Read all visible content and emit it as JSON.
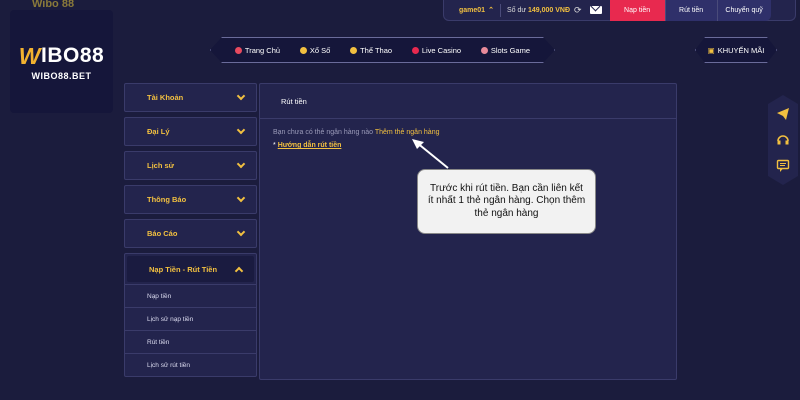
{
  "brand": {
    "logo_prefix": "W",
    "logo_rest": "IBO88",
    "logo_domain": "WIBO88.BET",
    "top_partial": "Wibo 88"
  },
  "topbar": {
    "username": "game01",
    "balance_label": "Số dư",
    "balance_value": "149,000 VNĐ",
    "deposit": "Nạp tiền",
    "withdraw": "Rút tiền",
    "transfer": "Chuyển quỹ"
  },
  "nav": {
    "items": [
      {
        "label": "Trang Chủ",
        "color": "#e84a5f"
      },
      {
        "label": "Xổ Số",
        "color": "#f2c040"
      },
      {
        "label": "Thể Thao",
        "color": "#f2c040"
      },
      {
        "label": "Live Casino",
        "color": "#e8294f"
      },
      {
        "label": "Slots Game",
        "color": "#e88a9a"
      }
    ],
    "promo": "KHUYẾN MÃI"
  },
  "sidebar": {
    "items": [
      {
        "label": "Tài Khoản"
      },
      {
        "label": "Đại Lý"
      },
      {
        "label": "Lịch sử"
      },
      {
        "label": "Thông Báo"
      },
      {
        "label": "Báo Cáo"
      }
    ],
    "group": {
      "label": "Nạp Tiền - Rút Tiền",
      "children": [
        "Nạp tiền",
        "Lịch sử nạp tiền",
        "Rút tiền",
        "Lịch sử rút tiền"
      ]
    }
  },
  "panel": {
    "title": "Rút tiền",
    "no_bank_text": "Bạn chưa có thẻ ngân hàng nào",
    "add_bank_link": "Thêm thẻ ngân hàng",
    "guide_prefix": "*",
    "guide_link": "Hướng dẫn rút tiền"
  },
  "callout": {
    "text": "Trước khi rút tiền. Bạn cần liên kết ít nhất 1 thẻ ngân hàng. Chọn thêm thẻ ngân hàng"
  },
  "colors": {
    "background": "#1b1c3d",
    "panel": "#23244d",
    "accent_gold": "#f2c040",
    "deposit_red": "#e8294f"
  }
}
